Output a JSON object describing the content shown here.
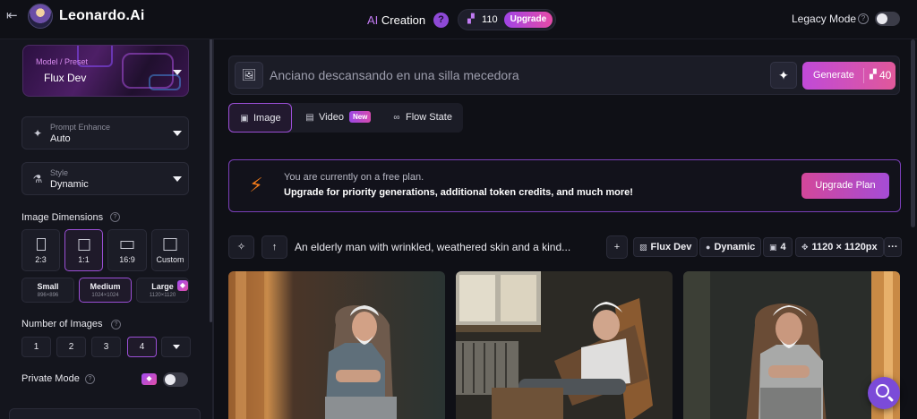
{
  "brand": {
    "name": "Leonardo",
    "suffix": ".Ai"
  },
  "topbar": {
    "creation_prefix": "AI",
    "creation_label": " Creation",
    "help_label": "?",
    "token_count": "110",
    "upgrade_label": "Upgrade",
    "legacy_label": "Legacy Mode",
    "legacy_on": false
  },
  "sidebar": {
    "model": {
      "label": "Model / Preset",
      "value": "Flux Dev"
    },
    "prompt_enhance": {
      "label": "Prompt Enhance",
      "value": "Auto"
    },
    "style": {
      "label": "Style",
      "value": "Dynamic"
    },
    "image_dimensions_title": "Image Dimensions",
    "ratios": [
      {
        "label": "2:3",
        "active": false
      },
      {
        "label": "1:1",
        "active": true
      },
      {
        "label": "16:9",
        "active": false
      },
      {
        "label": "Custom",
        "active": false
      }
    ],
    "sizes": [
      {
        "name": "Small",
        "dims": "896×896",
        "active": false
      },
      {
        "name": "Medium",
        "dims": "1024×1024",
        "active": true
      },
      {
        "name": "Large",
        "dims": "1120×1120",
        "active": false
      }
    ],
    "number_of_images_title": "Number of Images",
    "numbers": [
      "1",
      "2",
      "3",
      "4"
    ],
    "numbers_active": "4",
    "private_mode_label": "Private Mode",
    "private_on": false
  },
  "prompt": {
    "placeholder": "Anciano descansando en una silla mecedora",
    "generate_label": "Generate",
    "generate_cost": "40"
  },
  "mode_tabs": [
    {
      "label": "Image",
      "active": true
    },
    {
      "label": "Video",
      "badge": "New",
      "active": false
    },
    {
      "label": "Flow State",
      "active": false
    }
  ],
  "banner": {
    "line1": "You are currently on a free plan.",
    "line2": "Upgrade for priority generations, additional token credits, and much more!",
    "button": "Upgrade Plan"
  },
  "generation": {
    "prompt_text": "An elderly man with wrinkled, weathered skin and a kind...",
    "model_chip": "Flux Dev",
    "style_chip": "Dynamic",
    "count_chip": "4",
    "size_chip": "1120 × 1120px",
    "more_label": "···"
  },
  "colors": {
    "accent": "#9b4fd6",
    "brand_gradient_start": "#c04ad8",
    "brand_gradient_end": "#e0589a",
    "bolt": "#f07a1a",
    "background": "#0f1016"
  },
  "icons": [
    "back-arrow-icon",
    "help-icon",
    "token-icon",
    "image-upload-icon",
    "sparkle-icon",
    "bolt-icon",
    "search-icon"
  ]
}
